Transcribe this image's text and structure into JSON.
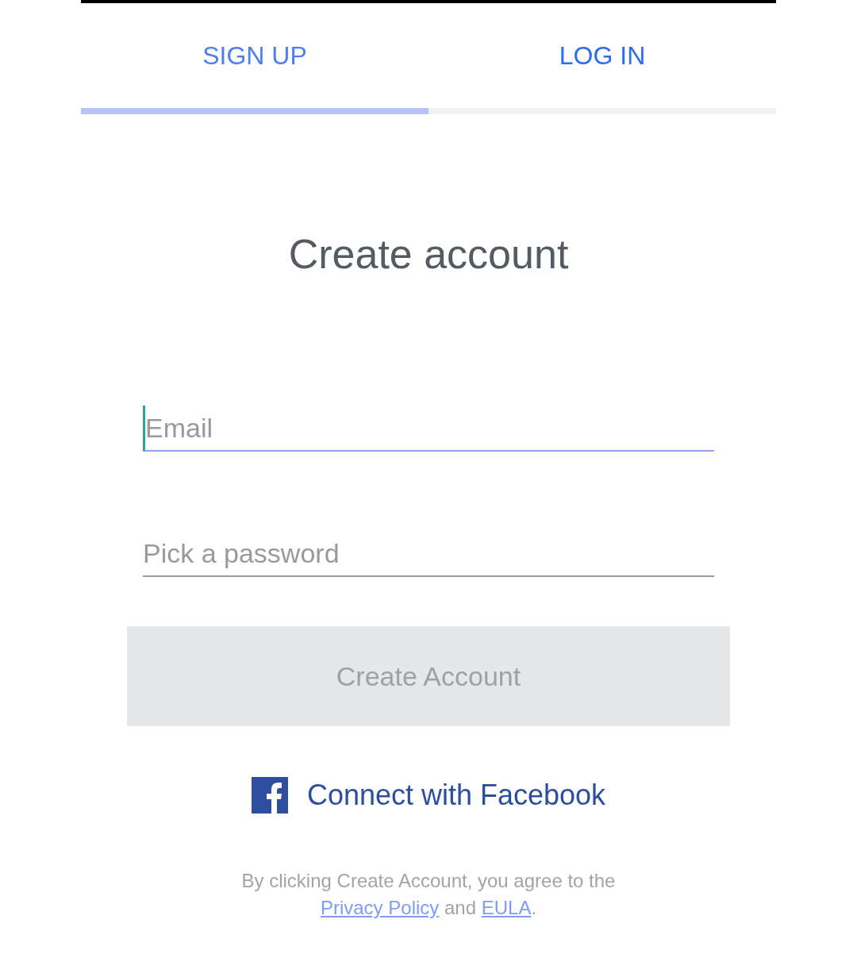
{
  "tabs": [
    {
      "label": "SIGN UP",
      "selected": true
    },
    {
      "label": "LOG IN",
      "selected": false
    }
  ],
  "heading": "Create account",
  "fields": [
    {
      "placeholder": "Email",
      "focused": true
    },
    {
      "placeholder": "Pick a password",
      "focused": false
    }
  ],
  "submit_button": {
    "label": "Create Account",
    "disabled": true
  },
  "facebook_link": {
    "label": "Connect with Facebook"
  },
  "terms": {
    "text": "By clicking Create Account, you agree to the",
    "links": [
      "Privacy Policy",
      "EULA"
    ],
    "joiner": "and",
    "end": "."
  }
}
